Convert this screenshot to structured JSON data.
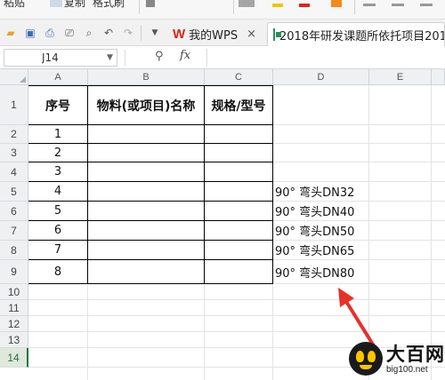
{
  "ribbon": {
    "paste_label": "粘贴",
    "copy_label": "复制",
    "format_painter_label": "格式刷"
  },
  "tabbar": {
    "tabs": [
      {
        "label": "我的WPS",
        "close": "×",
        "logo": "W"
      },
      {
        "label": "2018年研发课题所依托项目201",
        "close": ""
      }
    ]
  },
  "formula_bar": {
    "name_box": "J14",
    "fx": "fx",
    "formula": ""
  },
  "sheet": {
    "columns": [
      "A",
      "B",
      "C",
      "D",
      "E"
    ],
    "rows": [
      "1",
      "2",
      "3",
      "4",
      "5",
      "6",
      "7",
      "8",
      "9",
      "10",
      "11",
      "12",
      "13",
      "14"
    ],
    "headers": {
      "seq": "序号",
      "material": "物料(或项目)名称",
      "spec": "规格/型号"
    },
    "seq_values": [
      "1",
      "2",
      "3",
      "4",
      "5",
      "6",
      "7",
      "8"
    ],
    "d_values": [
      {
        "row": "5",
        "text": "90° 弯头DN32"
      },
      {
        "row": "6",
        "text": "90° 弯头DN40"
      },
      {
        "row": "7",
        "text": "90° 弯头DN50"
      },
      {
        "row": "8",
        "text": "90° 弯头DN65"
      },
      {
        "row": "9",
        "text": "90° 弯头DN80"
      }
    ],
    "active_row": "14",
    "accent": "#217346"
  },
  "annotation": {
    "arrow_color": "#e8302b"
  },
  "watermark": {
    "name": "大百网",
    "url": "big100.net"
  }
}
